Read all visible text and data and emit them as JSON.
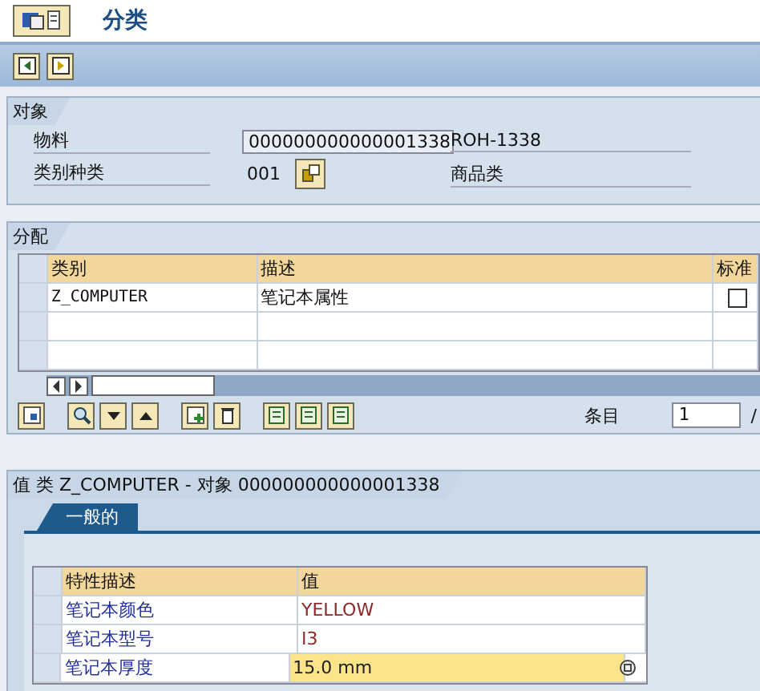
{
  "title": "分类",
  "object": {
    "label": "对象",
    "rows": [
      {
        "label": "物料",
        "value": "000000000000001338",
        "boxed": true,
        "note": "ROH-1338"
      },
      {
        "label": "类别种类",
        "value": "001",
        "boxed": false,
        "note": "商品类"
      }
    ]
  },
  "assignment": {
    "label": "分配",
    "columns": [
      "类别",
      "描述",
      "标准"
    ],
    "rows": [
      {
        "class": "Z_COMPUTER",
        "description": "笔记本属性",
        "standard": false
      }
    ],
    "entry_label": "条目",
    "entry_value": "1",
    "entry_sep": "/"
  },
  "values": {
    "title": "值 类 Z_COMPUTER - 对象 000000000000001338",
    "tabs": [
      {
        "label": "一般的",
        "selected": true
      }
    ],
    "columns": [
      "特性描述",
      "值"
    ],
    "rows": [
      {
        "name": "笔记本颜色",
        "value": "YELLOW",
        "focused": false
      },
      {
        "name": "笔记本型号",
        "value": "I3",
        "focused": false
      },
      {
        "name": "笔记本厚度",
        "value": "15.0 mm",
        "focused": true
      }
    ]
  }
}
